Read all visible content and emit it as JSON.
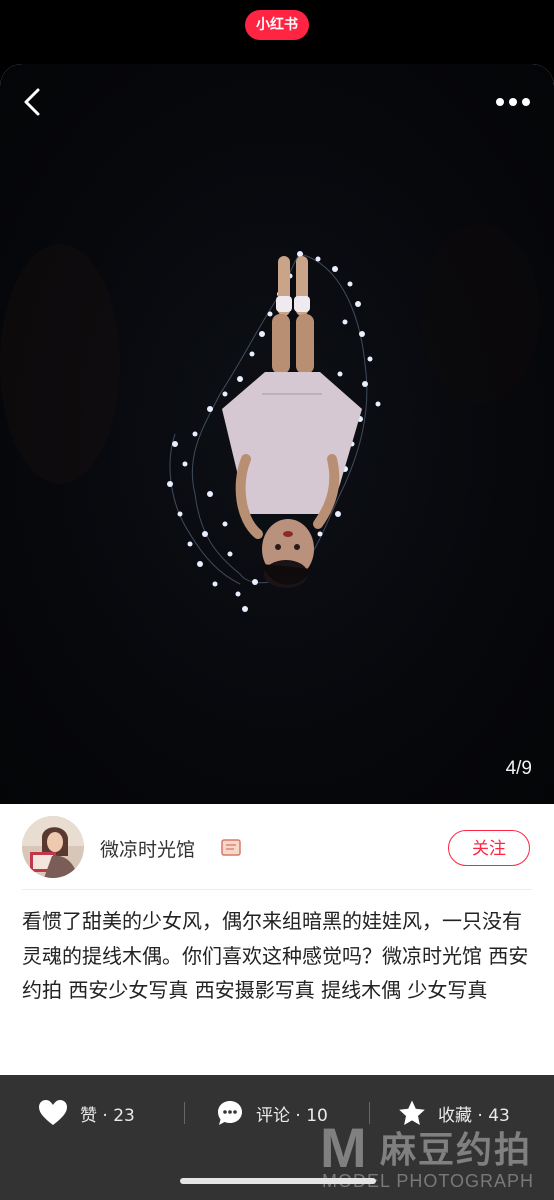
{
  "app": {
    "brand": "小红书"
  },
  "photo": {
    "page_indicator": "4/9"
  },
  "author": {
    "name": "微凉时光馆",
    "follow_label": "关注"
  },
  "post": {
    "text": "看惯了甜美的少女风，偶尔来组暗黑的娃娃风，一只没有灵魂的提线木偶。你们喜欢这种感觉吗？微凉时光馆  西安约拍  西安少女写真  西安摄影写真  提线木偶  少女写真"
  },
  "actions": {
    "like_label": "赞 · 23",
    "comment_label": "评论 · 10",
    "collect_label": "收藏 · 43"
  },
  "watermark": {
    "main": "麻豆约拍",
    "sub": "MODEL PHOTOGRAPH"
  },
  "colors": {
    "brand_red": "#ff2442",
    "bar_bg": "#333333"
  }
}
